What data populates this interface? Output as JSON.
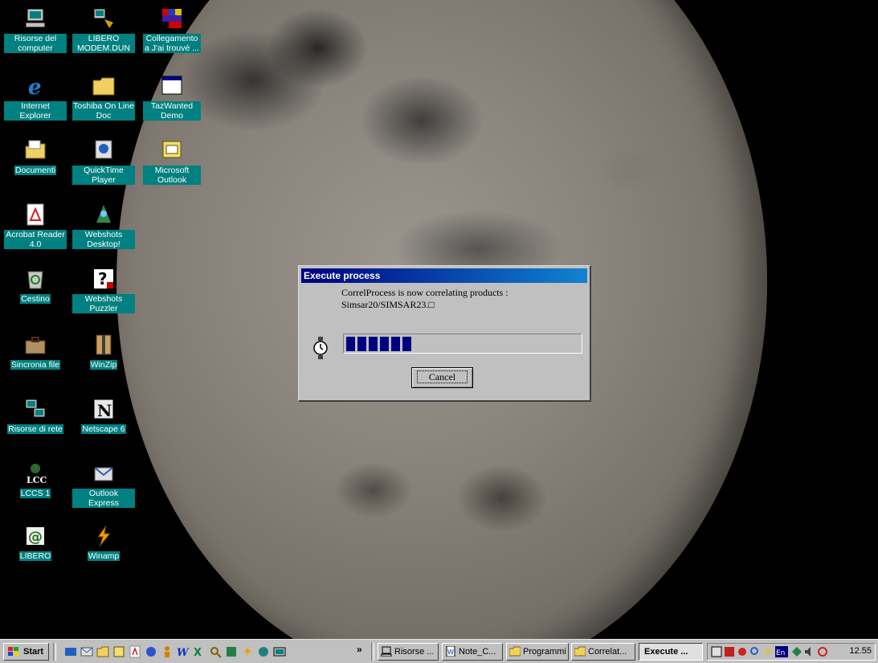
{
  "desktop_icons": [
    {
      "label": "Risorse del computer",
      "icon": "my-computer-icon"
    },
    {
      "label": "Internet Explorer",
      "icon": "internet-explorer-icon"
    },
    {
      "label": "Documenti",
      "icon": "documents-folder-icon"
    },
    {
      "label": "Acrobat Reader 4.0",
      "icon": "acrobat-icon"
    },
    {
      "label": "Cestino",
      "icon": "recycle-bin-icon"
    },
    {
      "label": "Sincronia file",
      "icon": "briefcase-icon"
    },
    {
      "label": "Risorse di rete",
      "icon": "network-icon"
    },
    {
      "label": "LCCS 1",
      "icon": "lccs-icon"
    },
    {
      "label": "LIBERO",
      "icon": "libero-icon"
    },
    {
      "label": "LIBERO MODEM.DUN",
      "icon": "dialup-icon"
    },
    {
      "label": "Toshiba On Line Doc",
      "icon": "folder-icon"
    },
    {
      "label": "QuickTime Player",
      "icon": "quicktime-icon"
    },
    {
      "label": "Webshots Desktop!",
      "icon": "webshots-icon"
    },
    {
      "label": "Webshots Puzzler",
      "icon": "puzzler-icon"
    },
    {
      "label": "WinZip",
      "icon": "winzip-icon"
    },
    {
      "label": "Netscape 6",
      "icon": "netscape-icon"
    },
    {
      "label": "Outlook Express",
      "icon": "outlook-express-icon"
    },
    {
      "label": "Winamp",
      "icon": "winamp-icon"
    },
    {
      "label": "Collegamento a J'ai trouvé ...",
      "icon": "shortcut-icon"
    },
    {
      "label": "TazWanted Demo",
      "icon": "window-app-icon"
    },
    {
      "label": "Microsoft Outlook",
      "icon": "outlook-icon"
    }
  ],
  "dialog": {
    "title": "Execute process",
    "message_line1": "CorrelProcess is now correlating products :",
    "message_line2": "Simsar20/SIMSAR23.□",
    "progress_segments_filled": 6,
    "progress_segments_total": 24,
    "cancel_label": "Cancel"
  },
  "taskbar": {
    "start_label": "Start",
    "overflow_label": "»",
    "tasks": [
      {
        "label": "Risorse ...",
        "icon": "my-computer-icon"
      },
      {
        "label": "Note_C...",
        "icon": "word-doc-icon"
      },
      {
        "label": "Programmi",
        "icon": "folder-icon"
      },
      {
        "label": "Correlat...",
        "icon": "folder-icon"
      },
      {
        "label": "Execute ...",
        "icon": "none",
        "active": true
      }
    ],
    "clock": "12.55"
  },
  "colors": {
    "teal_label": "#008080",
    "title_start": "#000080",
    "title_end": "#1084d0",
    "progress_fill": "#000080"
  }
}
